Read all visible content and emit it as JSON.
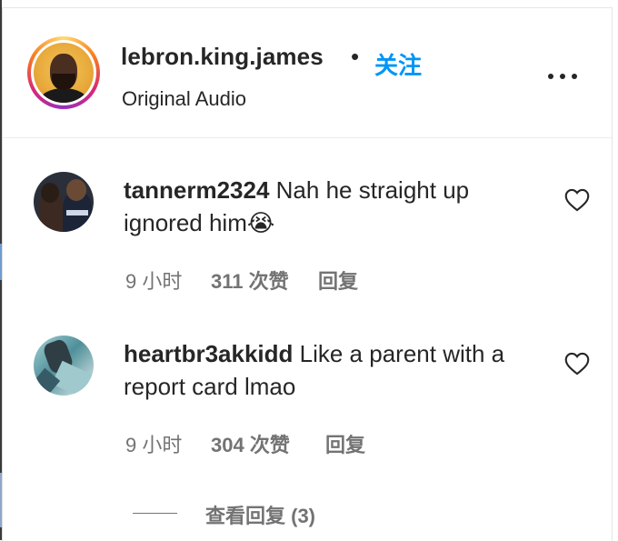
{
  "header": {
    "username": "lebron.king.james",
    "separator": "•",
    "follow_label": "关注",
    "subtitle": "Original Audio",
    "more_icon": "more-horizontal-icon"
  },
  "comments": [
    {
      "username": "tannerm2324",
      "text": "Nah he straight up ignored him😭",
      "time": "9 小时",
      "likes": "311 次赞",
      "reply_label": "回复",
      "like_icon": "heart-outline-icon"
    },
    {
      "username": "heartbr3akkidd",
      "text": "Like a parent with a report card lmao",
      "time": "9 小时",
      "likes": "304 次赞",
      "reply_label": "回复",
      "like_icon": "heart-outline-icon"
    }
  ],
  "view_replies": {
    "label": "查看回复 (3)"
  },
  "colors": {
    "text": "#262626",
    "muted": "#737373",
    "link": "#0095f6"
  }
}
